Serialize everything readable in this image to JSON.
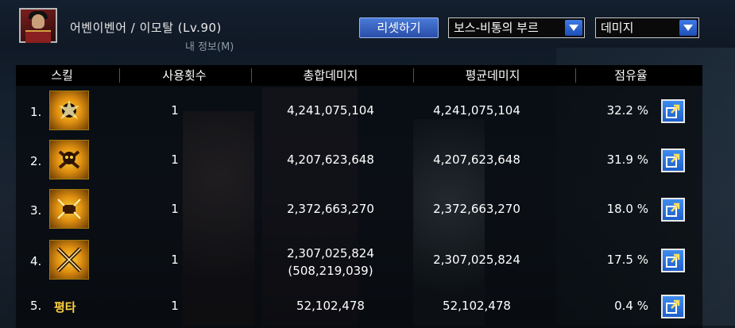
{
  "header": {
    "character_title": "어벤이벤어 / 이모탈 (Lv.90)",
    "subtitle": "내 정보(M)",
    "reset_label": "리셋하기",
    "boss_select_value": "보스-비통의 부르",
    "type_select_value": "데미지"
  },
  "table": {
    "columns": [
      "스킬",
      "사용횟수",
      "총합데미지",
      "평균데미지",
      "점유율"
    ],
    "rows": [
      {
        "rank": "1.",
        "skill_icon": "flame-burst-icon",
        "skill_text": "",
        "uses": "1",
        "total": "4,241,075,104",
        "total_sub": "",
        "avg": "4,241,075,104",
        "share": "32.2 %"
      },
      {
        "rank": "2.",
        "skill_icon": "skull-crossbones-icon",
        "skill_text": "",
        "uses": "1",
        "total": "4,207,623,648",
        "total_sub": "",
        "avg": "4,207,623,648",
        "share": "31.9 %"
      },
      {
        "rank": "3.",
        "skill_icon": "fist-strike-icon",
        "skill_text": "",
        "uses": "1",
        "total": "2,372,663,270",
        "total_sub": "",
        "avg": "2,372,663,270",
        "share": "18.0 %"
      },
      {
        "rank": "4.",
        "skill_icon": "cross-slash-icon",
        "skill_text": "",
        "uses": "1",
        "total": "2,307,025,824",
        "total_sub": "(508,219,039)",
        "avg": "2,307,025,824",
        "share": "17.5 %"
      },
      {
        "rank": "5.",
        "skill_icon": "",
        "skill_text": "평타",
        "uses": "1",
        "total": "52,102,478",
        "total_sub": "",
        "avg": "52,102,478",
        "share": "0.4 %"
      }
    ]
  },
  "colors": {
    "accent": "#2a5fc8",
    "skill_text": "#ffd040"
  }
}
